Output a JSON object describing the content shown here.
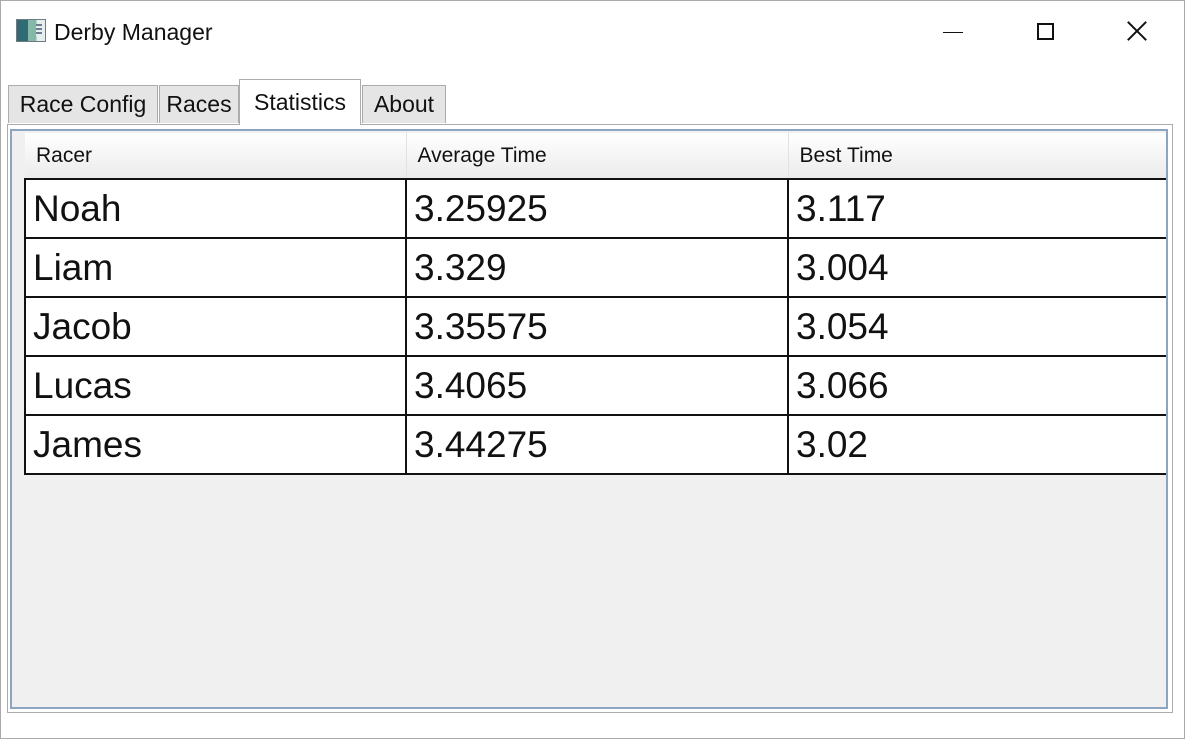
{
  "window": {
    "title": "Derby Manager",
    "icon": "app-icon"
  },
  "tabs": [
    {
      "label": "Race Config",
      "active": false
    },
    {
      "label": "Races",
      "active": false
    },
    {
      "label": "Statistics",
      "active": true
    },
    {
      "label": "About",
      "active": false
    }
  ],
  "stats_table": {
    "columns": [
      "Racer",
      "Average Time",
      "Best Time"
    ],
    "rows": [
      {
        "racer": "Noah",
        "average": "3.25925",
        "best": "3.117"
      },
      {
        "racer": "Liam",
        "average": "3.329",
        "best": "3.004"
      },
      {
        "racer": "Jacob",
        "average": "3.35575",
        "best": "3.054"
      },
      {
        "racer": "Lucas",
        "average": "3.4065",
        "best": "3.066"
      },
      {
        "racer": "James",
        "average": "3.44275",
        "best": "3.02"
      }
    ]
  },
  "colors": {
    "grid_border": "#8ea5c2",
    "cell_border": "#111111",
    "empty_area": "#f0f0f0"
  }
}
